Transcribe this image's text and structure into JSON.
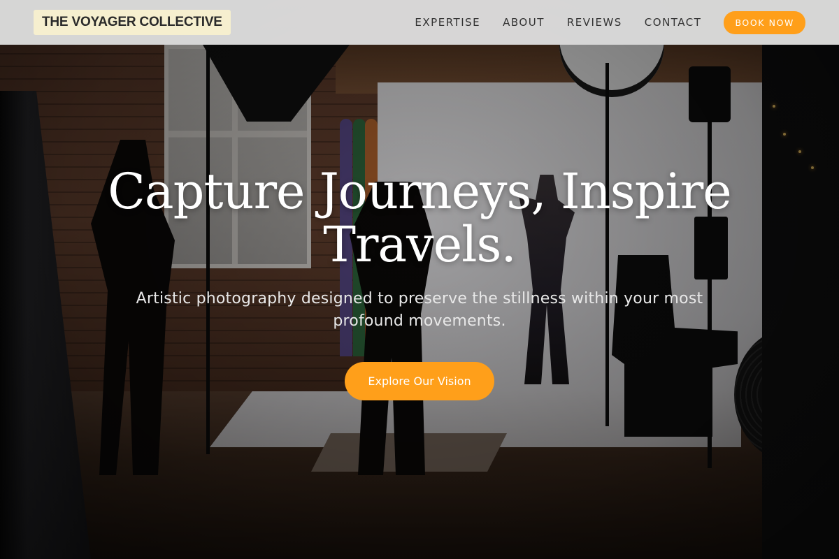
{
  "header": {
    "logo_text": "THE VOYAGER COLLECTIVE",
    "nav": [
      {
        "label": "EXPERTISE"
      },
      {
        "label": "ABOUT"
      },
      {
        "label": "REVIEWS"
      },
      {
        "label": "CONTACT"
      }
    ],
    "book_button": "BOOK NOW"
  },
  "hero": {
    "title": "Capture Journeys, Inspire Travels.",
    "subtitle": "Artistic photography designed to preserve the stillness within your most profound movements.",
    "cta_label": "Explore Our Vision"
  },
  "colors": {
    "accent": "#ff9f1a",
    "header_bg": "#e2e2e2",
    "logo_bg": "#f6efcf"
  }
}
